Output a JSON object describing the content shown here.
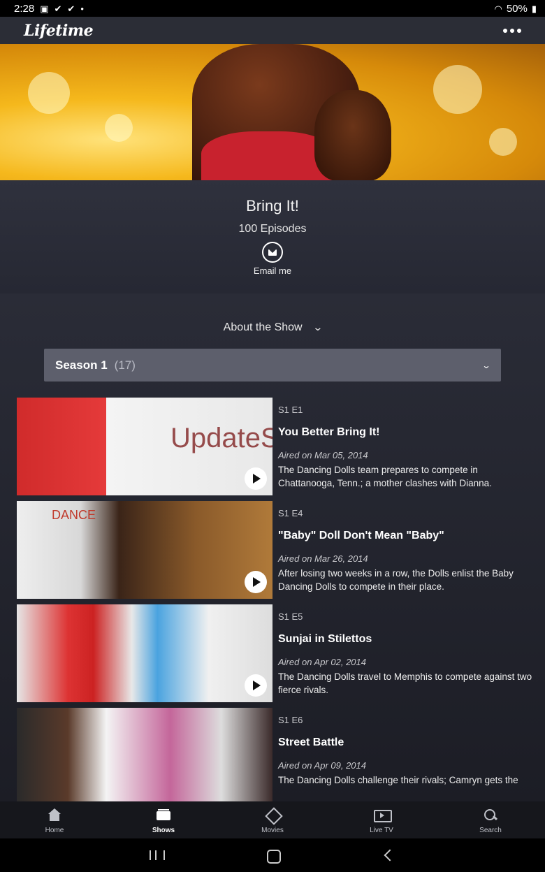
{
  "status_bar": {
    "time": "2:28",
    "battery": "50%"
  },
  "header": {
    "logo": "Lifetime",
    "more_icon": "more-horizontal-icon"
  },
  "show": {
    "title": "Bring It!",
    "episodes": "100 Episodes",
    "email_label": "Email me"
  },
  "about": {
    "label": "About the Show"
  },
  "season": {
    "name": "Season 1",
    "count": "(17)"
  },
  "episodes": [
    {
      "code": "S1 E1",
      "title": "You Better Bring It!",
      "aired": "Aired on Mar 05, 2014",
      "description": "The Dancing Dolls team prepares to compete in Chattanooga, Tenn.; a mother clashes with Dianna.",
      "watermark": "UpdateSta"
    },
    {
      "code": "S1 E4",
      "title": "\"Baby\" Doll Don't Mean \"Baby\"",
      "aired": "Aired on Mar 26, 2014",
      "description": "After losing two weeks in a row, the Dolls enlist the Baby Dancing Dolls to compete in their place.",
      "thumb_text": "DANCE"
    },
    {
      "code": "S1 E5",
      "title": "Sunjai in Stilettos",
      "aired": "Aired on Apr 02, 2014",
      "description": "The Dancing Dolls travel to Memphis to compete against two fierce rivals."
    },
    {
      "code": "S1 E6",
      "title": "Street Battle",
      "aired": "Aired on Apr 09, 2014",
      "description": "The Dancing Dolls challenge their rivals; Camryn gets the"
    }
  ],
  "bottom_nav": [
    {
      "label": "Home",
      "icon": "home-icon"
    },
    {
      "label": "Shows",
      "icon": "shows-icon",
      "active": true
    },
    {
      "label": "Movies",
      "icon": "movies-icon"
    },
    {
      "label": "Live TV",
      "icon": "live-tv-icon"
    },
    {
      "label": "Search",
      "icon": "search-icon"
    }
  ],
  "colors": {
    "header_bg": "#2b2d36",
    "season_bar": "#5d5f6c",
    "nav_bg": "#16171c"
  }
}
